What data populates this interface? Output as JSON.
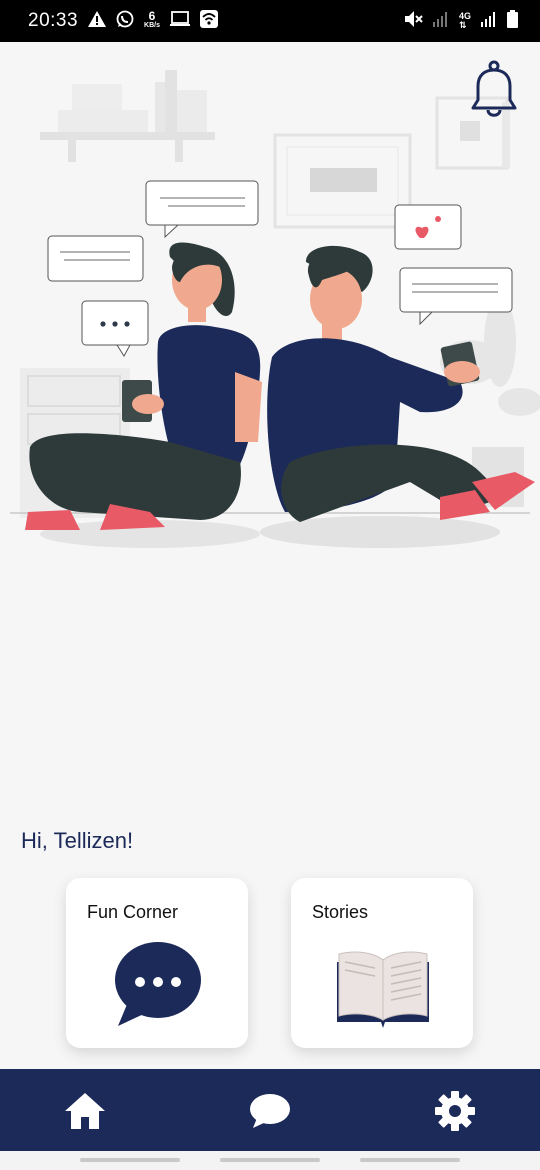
{
  "status_bar": {
    "time": "20:33",
    "speed_value": "6",
    "speed_unit": "KB/s",
    "network_type": "4G",
    "icons": [
      "alert-icon",
      "whatsapp-icon",
      "cast-icon",
      "wifi-icon",
      "mute-icon",
      "signal-icon",
      "battery-icon"
    ]
  },
  "illustration": {
    "name": "two-people-texting-illustration",
    "accent_color": "#e85a66",
    "shirt_color": "#1c2a5a"
  },
  "header": {
    "bell_icon": "bell-icon"
  },
  "greeting": "Hi, Tellizen!",
  "cards": [
    {
      "title": "Fun Corner",
      "icon": "chat-bubble-icon"
    },
    {
      "title": "Stories",
      "icon": "open-book-icon"
    }
  ],
  "bottom_nav": {
    "background": "#1c2a5a",
    "items": [
      {
        "icon": "home-icon",
        "active": true
      },
      {
        "icon": "chat-icon",
        "active": false
      },
      {
        "icon": "gear-icon",
        "active": false
      }
    ]
  },
  "colors": {
    "navy": "#1c2a5a",
    "background": "#f6f6f6",
    "card": "#ffffff",
    "shoe_red": "#e85a66"
  }
}
